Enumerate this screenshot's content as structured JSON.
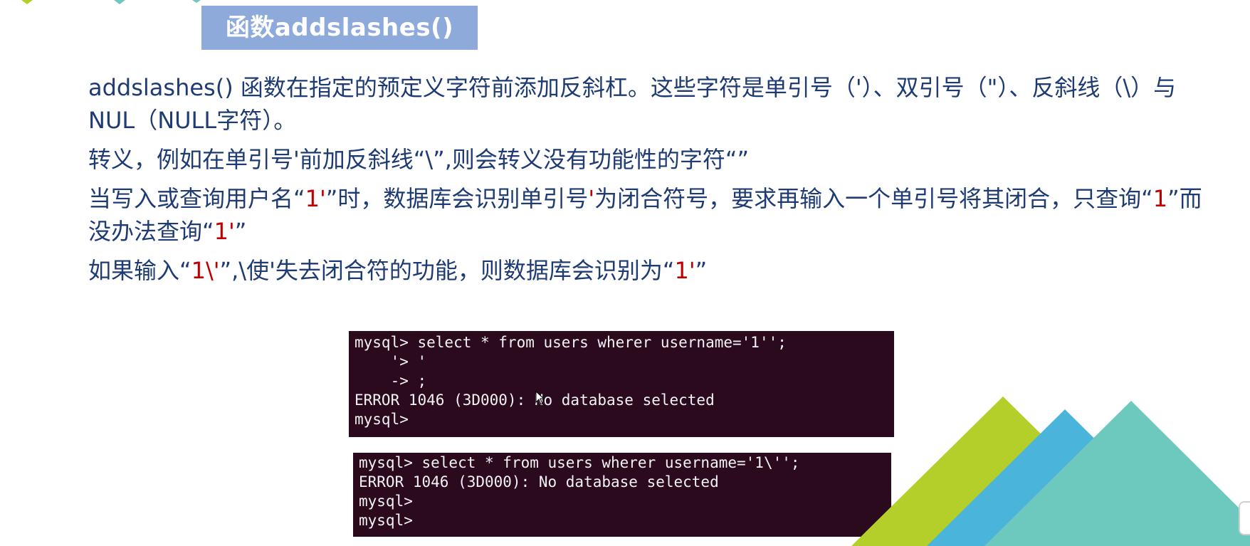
{
  "slide": {
    "title": "函数addslashes()",
    "paragraphs": {
      "p1": "addslashes() 函数在指定的预定义字符前添加反斜杠。这些字符是单引号（'）、双引号（\"）、反斜线（\\）与NUL（NULL字符）。",
      "p2": "转义，例如在单引号'前加反斜线“\\”,则会转义没有功能性的字符“”",
      "p3": {
        "t1": "当写入或查询用户名“",
        "r1": "1'",
        "t2": "”时，数据库会识别单引号",
        "r2": "'",
        "t3": "为闭合符号，要求再输入一个单引号将其闭合，只查询“",
        "r3": "1",
        "t4": "”而没办法查询“",
        "r4": "1'",
        "t5": "”"
      },
      "p4": {
        "t1": "如果输入“",
        "r1": "1\\'",
        "t2": "”,\\使'失去闭合符的功能，则数据库会识别为“",
        "r2": "1'",
        "t3": "”"
      }
    },
    "terminal1": {
      "lines": [
        "mysql> select * from users wherer username='1'';",
        "    '> '",
        "    -> ;",
        "ERROR 1046 (3D000): No database selected",
        "mysql> "
      ]
    },
    "terminal2": {
      "lines": [
        "mysql> select * from users wherer username='1\\'';",
        "ERROR 1046 (3D000): No database selected",
        "mysql> ",
        "mysql> "
      ]
    },
    "colors": {
      "title_bg": "#8eaadb",
      "text": "#1f3b73",
      "highlight": "#c00000",
      "terminal_bg": "#2c0a1e",
      "deco_green": "#b5cf2a",
      "deco_blue": "#4ab4da",
      "deco_teal": "#6dc8bd"
    }
  }
}
